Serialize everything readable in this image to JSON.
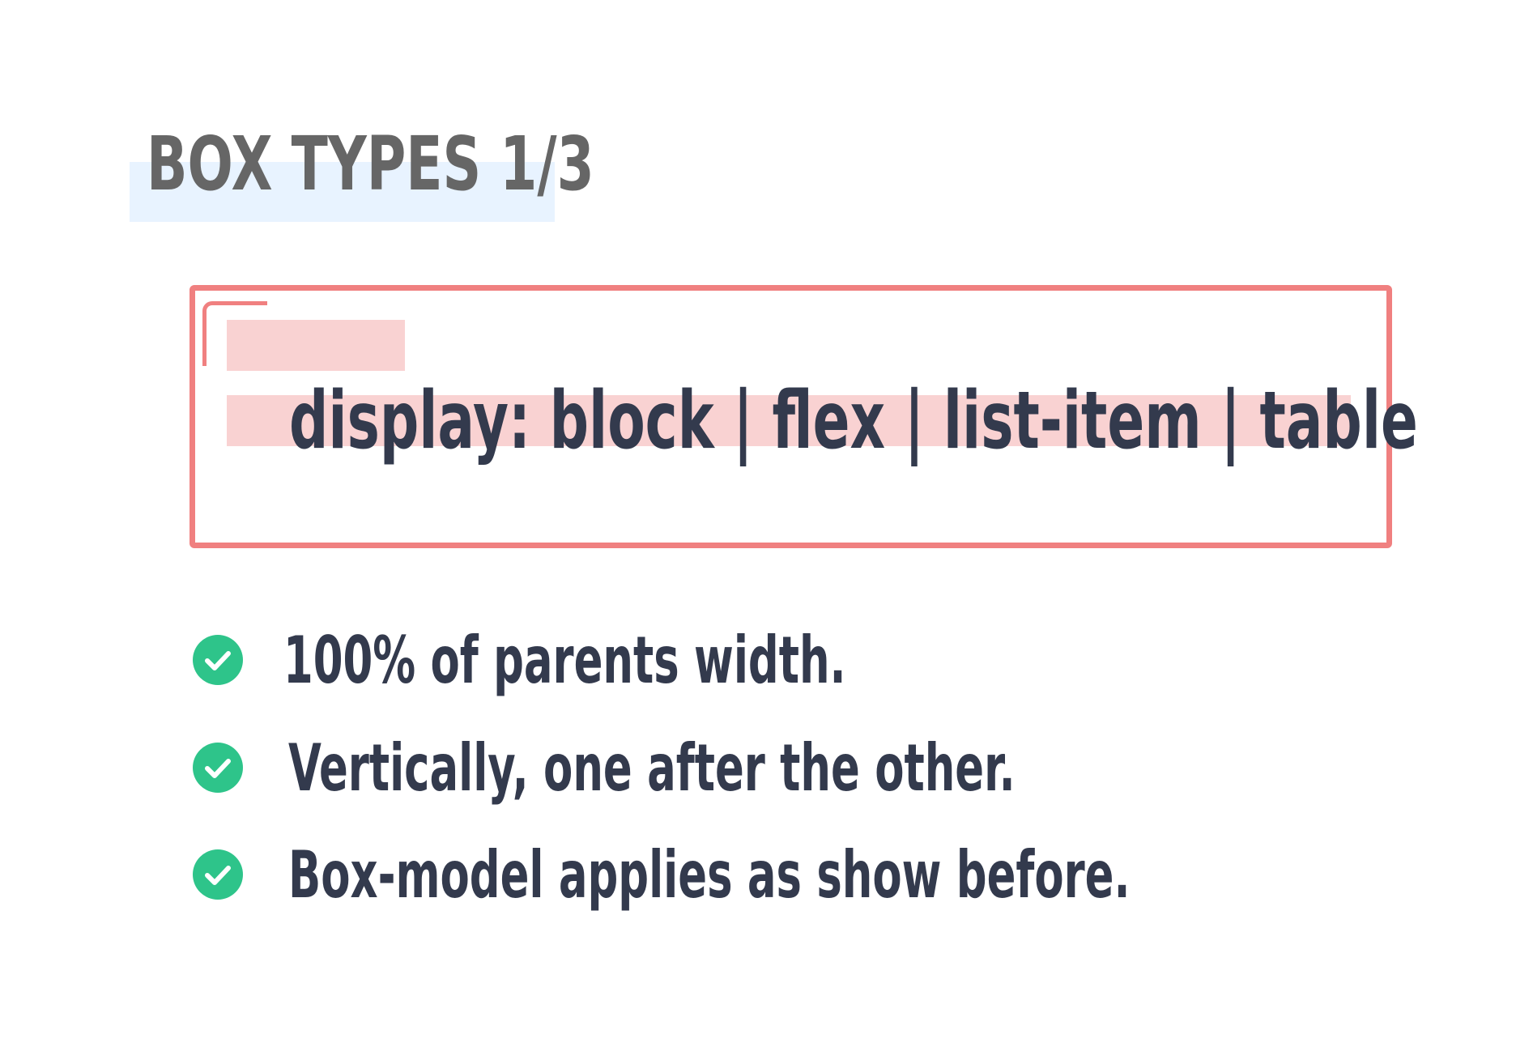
{
  "title": "BOX TYPES 1/3",
  "code_line": "display: block | flex | list-item | table",
  "bullets": [
    {
      "text": "100% of parents width.",
      "icon": "check-circle-icon"
    },
    {
      "text": "Vertically, one after the other.",
      "icon": "check-circle-icon"
    },
    {
      "text": "Box-model applies as show before.",
      "icon": "check-circle-icon"
    }
  ],
  "colors": {
    "title_text": "#666666",
    "title_highlight": "#e8f3ff",
    "box_border": "#f08080",
    "box_highlight": "#f9d2d2",
    "body_text": "#333a4d",
    "check_green": "#2ec48a"
  }
}
